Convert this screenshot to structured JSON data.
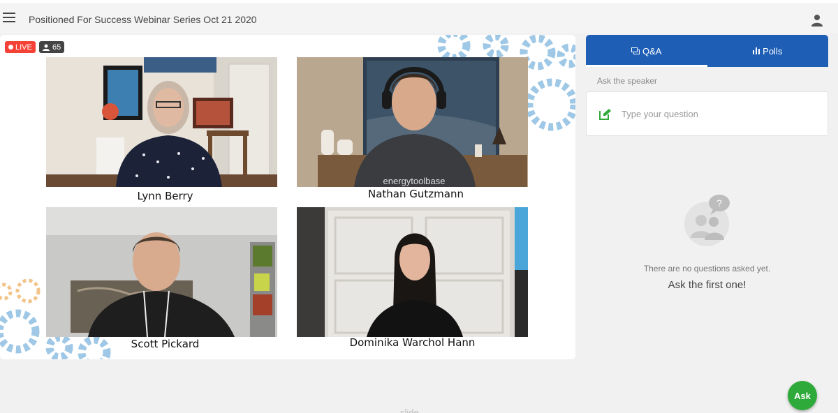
{
  "header": {
    "title": "Positioned For Success Webinar Series Oct 21 2020"
  },
  "stage": {
    "live_label": "LIVE",
    "viewer_count": "65",
    "participants": [
      {
        "name": "Lynn Berry"
      },
      {
        "name": "Nathan Gutzmann"
      },
      {
        "name": "Scott Pickard"
      },
      {
        "name": "Dominika Warchol Hann"
      }
    ],
    "shirt_logo_text": "energytoolbase"
  },
  "panel": {
    "tabs": [
      {
        "label": "Q&A",
        "icon": "chat-icon"
      },
      {
        "label": "Polls",
        "icon": "bar-chart-icon"
      }
    ],
    "ask_label": "Ask the speaker",
    "question_placeholder": "Type your question",
    "empty_line1": "There are no questions asked yet.",
    "empty_line2": "Ask the first one!",
    "empty_icon_text": "?"
  },
  "ask_button_label": "Ask",
  "bottom_partial_text": "slide",
  "colors": {
    "accent": "#1e5eb5",
    "live": "#f44336",
    "ask": "#2eaa3a",
    "gear": "#9ec8e6",
    "gear_orange": "#f2c48a"
  }
}
